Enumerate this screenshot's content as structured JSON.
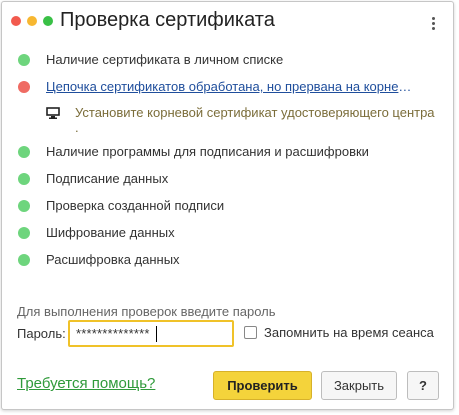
{
  "window": {
    "title": "Проверка сертификата"
  },
  "checks": [
    {
      "label": "Наличие сертификата в личном списке",
      "status": "ok"
    },
    {
      "label": "Цепочка сертификатов обработана, но прервана на корнев...",
      "status": "fail"
    },
    {
      "label": "Наличие программы для подписания и расшифровки",
      "status": "ok"
    },
    {
      "label": "Подписание данных",
      "status": "ok"
    },
    {
      "label": "Проверка созданной подписи",
      "status": "ok"
    },
    {
      "label": "Шифрование данных",
      "status": "ok"
    },
    {
      "label": "Расшифровка данных",
      "status": "ok"
    }
  ],
  "hint": {
    "text": "Установите корневой сертификат удостоверяющего центра",
    "tail": "."
  },
  "password": {
    "caption": "Для выполнения проверок введите пароль",
    "label": "Пароль:",
    "value": "**************",
    "remember_label": "Запомнить на время сеанса",
    "remember_checked": false
  },
  "footer": {
    "help_link": "Требуется помощь?",
    "check_button": "Проверить",
    "close_button": "Закрыть",
    "question_button": "?"
  },
  "colors": {
    "ok": "#6ed57d",
    "fail": "#ef6b63",
    "primary": "#f4d33b",
    "link": "#1f4e9c",
    "help": "#2f9a3a"
  }
}
